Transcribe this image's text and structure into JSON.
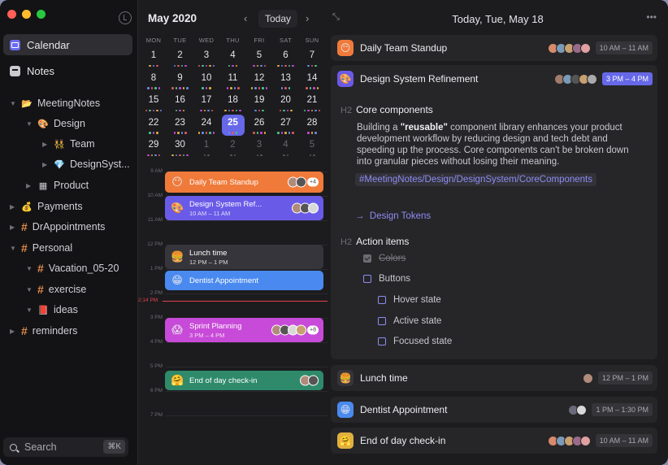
{
  "sidebar": {
    "nav": [
      {
        "label": "Calendar",
        "icon": "calendar-icon",
        "active": true
      },
      {
        "label": "Notes",
        "icon": "notes-icon",
        "active": false
      }
    ],
    "tree": [
      {
        "label": "MeetingNotes",
        "icon": "folder-icon",
        "emoji": "📂"
      },
      {
        "label": "Design",
        "icon": "palette-icon",
        "emoji": "🎨"
      },
      {
        "label": "Team",
        "icon": "people-icon",
        "emoji": "👯"
      },
      {
        "label": "DesignSyst...",
        "icon": "gem-icon",
        "emoji": "💎"
      },
      {
        "label": "Product",
        "icon": "grid-icon",
        "emoji": "▦"
      },
      {
        "label": "Payments",
        "icon": "money-bag-icon",
        "emoji": "💰"
      },
      {
        "label": "DrAppointments",
        "icon": "hash-icon"
      },
      {
        "label": "Personal",
        "icon": "hash-icon"
      },
      {
        "label": "Vacation_05-20",
        "icon": "hash-icon"
      },
      {
        "label": "exercise",
        "icon": "hash-icon"
      },
      {
        "label": "ideas",
        "icon": "book-icon",
        "emoji": "📕"
      },
      {
        "label": "reminders",
        "icon": "hash-icon"
      }
    ],
    "search": {
      "label": "Search",
      "shortcut": "⌘K"
    }
  },
  "calendar": {
    "month": "May 2020",
    "today_label": "Today",
    "prev": "‹",
    "next": "›",
    "weekdays": [
      "MON",
      "TUE",
      "WED",
      "THU",
      "FRI",
      "SAT",
      "SUN"
    ],
    "weeks": [
      [
        "1",
        "2",
        "3",
        "4",
        "5",
        "6",
        "7"
      ],
      [
        "8",
        "9",
        "10",
        "11",
        "12",
        "13",
        "14"
      ],
      [
        "15",
        "16",
        "17",
        "18",
        "19",
        "20",
        "21"
      ],
      [
        "22",
        "23",
        "24",
        "25",
        "26",
        "27",
        "28"
      ],
      [
        "29",
        "30",
        "1",
        "2",
        "3",
        "4",
        "5"
      ]
    ],
    "selected": "25"
  },
  "timeline": {
    "hours": [
      "9 AM",
      "10 AM",
      "11 AM",
      "12 PM",
      "1 PM",
      "2 PM",
      "3 PM",
      "4 PM",
      "5 PM",
      "6 PM",
      "7 PM"
    ],
    "now": "2:14 PM",
    "events": [
      {
        "title": "Daily Team Standup",
        "time": "",
        "emoji": "😶",
        "color": "#f07a3a",
        "extra": "+4"
      },
      {
        "title": "Design System Ref...",
        "time": "10 AM – 11 AM",
        "emoji": "🎨",
        "color": "#6a5ae8",
        "extra": ""
      },
      {
        "title": "Lunch time",
        "time": "12 PM – 1 PM",
        "emoji": "🍔",
        "color": "#35353b",
        "extra": ""
      },
      {
        "title": "Dentist Appointment",
        "time": "",
        "emoji": "😁",
        "color": "#4a8af0",
        "extra": ""
      },
      {
        "title": "Sprint Planning",
        "time": "3 PM – 4 PM",
        "emoji": "😱",
        "color": "#c84ad8",
        "extra": "+8"
      },
      {
        "title": "End of day check-in",
        "time": "",
        "emoji": "🤗",
        "color": "#2e8a6a",
        "extra": ""
      }
    ]
  },
  "detail": {
    "title": "Today, Tue, May 18",
    "cards": [
      {
        "title": "Daily Team Standup",
        "time": "10 AM – 11 AM",
        "emoji": "😶",
        "bg": "#f07a3a"
      },
      {
        "title": "Design System Refinement",
        "time": "3 PM – 4 PM",
        "emoji": "🎨",
        "bg": "#6a5ae8"
      },
      {
        "title": "Lunch time",
        "time": "12 PM – 1 PM",
        "emoji": "🍔",
        "bg": "#35353b"
      },
      {
        "title": "Dentist Appointment",
        "time": "1 PM – 1:30 PM",
        "emoji": "😁",
        "bg": "#4a8af0"
      },
      {
        "title": "End of day check-in",
        "time": "10 AM – 11 AM",
        "emoji": "🤗",
        "bg": "#e0b040"
      }
    ],
    "note": {
      "h2_prefix": "H2",
      "heading1": "Core components",
      "para_before": "Building a ",
      "para_bold": "reusable",
      "para_after": " component library enhances your product development workflow by reducing design and tech debt and speeding up the process. Core components can't be broken down into granular pieces without losing their meaning.",
      "tag": "#MeetingNotes/Design/DesignSystem/CoreComponents",
      "link_arrow": "→",
      "link": "Design Tokens",
      "heading2": "Action items",
      "checks": [
        {
          "label": "Colors",
          "done": true
        },
        {
          "label": "Buttons",
          "done": false
        },
        {
          "label": "Hover state",
          "done": false
        },
        {
          "label": "Active state",
          "done": false
        },
        {
          "label": "Focused state",
          "done": false
        }
      ]
    }
  }
}
